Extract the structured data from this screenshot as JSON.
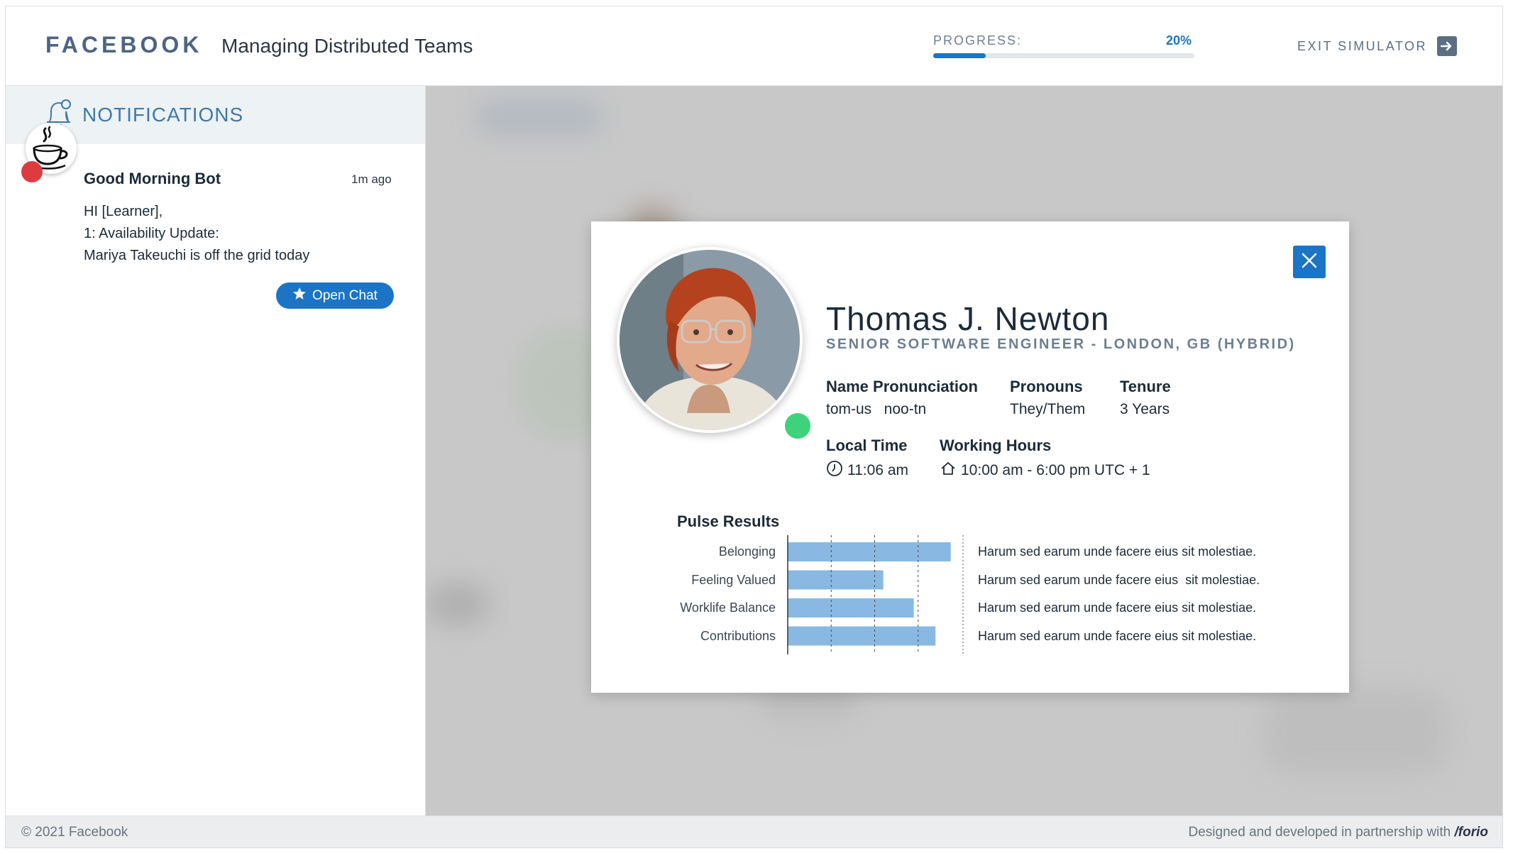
{
  "header": {
    "brand": "FACEBOOK",
    "course_title": "Managing Distributed Teams",
    "progress_label": "PROGRESS:",
    "progress_text": "20%",
    "progress_value": 0.2,
    "exit_label": "EXIT SIMULATOR"
  },
  "sidebar": {
    "title": "NOTIFICATIONS",
    "notification": {
      "sender": "Good Morning Bot",
      "time": "1m ago",
      "lines": [
        "HI [Learner],",
        "1: Availability Update:",
        "Mariya  Takeuchi is off the grid today"
      ],
      "button_label": "Open Chat"
    }
  },
  "profile": {
    "name": "Thomas J. Newton",
    "role": "SENIOR SOFTWARE ENGINEER - LONDON, GB (HYBRID)",
    "fields": {
      "pronunciation_label": "Name Pronunciation",
      "pronunciation_value": "tom-us   noo-tn",
      "pronouns_label": "Pronouns",
      "pronouns_value": "They/Them",
      "tenure_label": "Tenure",
      "tenure_value": "3 Years",
      "local_time_label": "Local Time",
      "local_time_value": "11:06 am",
      "working_hours_label": "Working Hours",
      "working_hours_value": "10:00 am - 6:00 pm UTC + 1"
    },
    "status_color": "#3ed27a"
  },
  "chart_data": {
    "type": "bar",
    "orientation": "horizontal",
    "title": "Pulse Results",
    "categories": [
      "Belonging",
      "Feeling Valued",
      "Worklife Balance",
      "Contributions"
    ],
    "values": [
      3.75,
      2.2,
      2.9,
      3.4
    ],
    "xlim": [
      0,
      4
    ],
    "gridlines": [
      1,
      2,
      3
    ],
    "bar_color": "#89b9e3",
    "comments": [
      "Harum sed earum unde facere eius sit molestiae.",
      "Harum sed earum unde facere eius  sit molestiae.",
      "Harum sed earum unde facere eius sit molestiae.",
      "Harum sed earum unde facere eius sit molestiae."
    ]
  },
  "footer": {
    "copyright": "© 2021 Facebook",
    "credit_prefix": "Designed and developed in partnership with ",
    "credit_brand": "/forio"
  },
  "colors": {
    "accent": "#1b74c5",
    "notification_dot": "#de3b40"
  }
}
